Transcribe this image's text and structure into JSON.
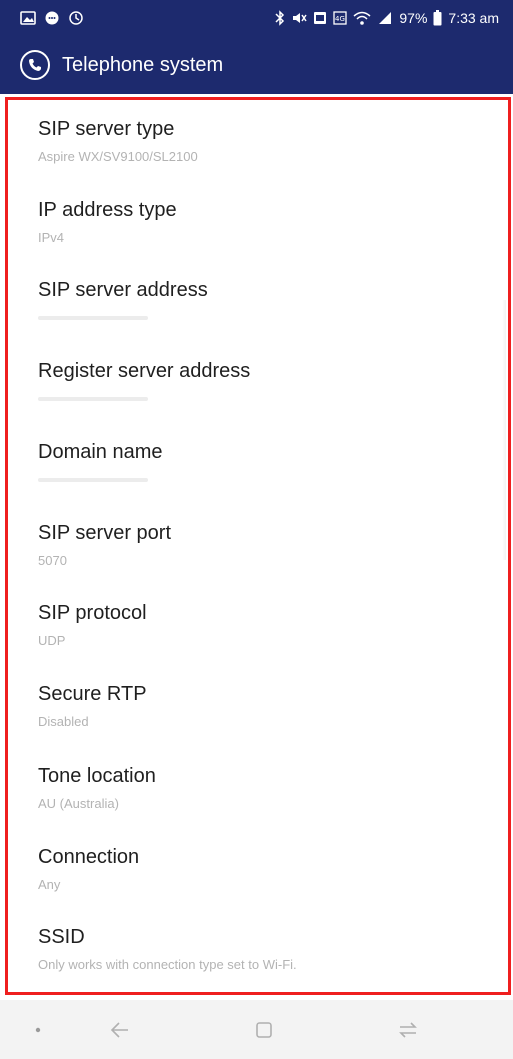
{
  "status_bar": {
    "battery_percent": "97%",
    "time": "7:33 am",
    "icons": [
      "gallery-icon",
      "message-icon",
      "sync-icon",
      "bluetooth-icon",
      "mute-icon",
      "alarm-icon",
      "data-icon",
      "wifi-icon",
      "signal-icon",
      "battery-icon"
    ]
  },
  "app_bar": {
    "title": "Telephone system",
    "icon": "phone-circle-icon",
    "background": "#1d2a6e"
  },
  "highlight_color": "#ef1f1f",
  "settings": [
    {
      "title": "SIP server type",
      "value": "Aspire WX/SV9100/SL2100"
    },
    {
      "title": "IP address type",
      "value": "IPv4"
    },
    {
      "title": "SIP server address",
      "value": ""
    },
    {
      "title": "Register server address",
      "value": ""
    },
    {
      "title": "Domain name",
      "value": ""
    },
    {
      "title": "SIP server port",
      "value": "5070"
    },
    {
      "title": "SIP protocol",
      "value": "UDP"
    },
    {
      "title": "Secure RTP",
      "value": "Disabled"
    },
    {
      "title": "Tone location",
      "value": "AU (Australia)"
    },
    {
      "title": "Connection",
      "value": "Any"
    },
    {
      "title": "SSID",
      "value": "Only works with connection type set to Wi-Fi."
    }
  ],
  "nav_bar": {
    "icons": [
      "dot-icon",
      "back-icon",
      "home-icon",
      "recents-icon"
    ]
  }
}
